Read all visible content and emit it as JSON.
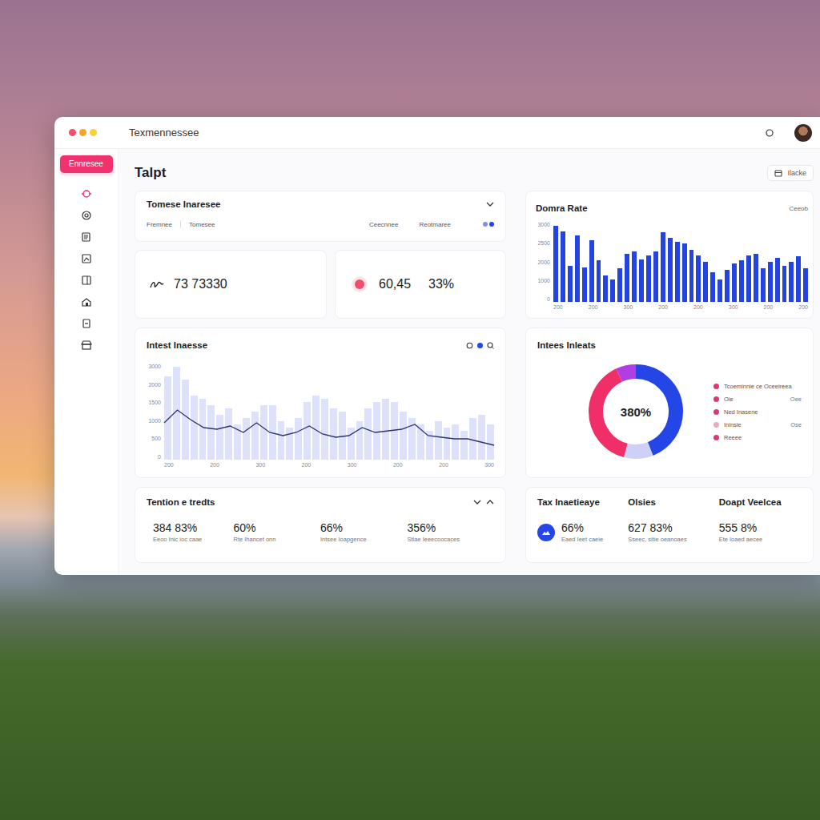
{
  "window": {
    "title": "Texmennessee",
    "dots": [
      {
        "color": "#f0506e"
      },
      {
        "color": "#f5a623"
      },
      {
        "color": "#f7d13c"
      }
    ]
  },
  "sidebar": {
    "button": "Ennresee"
  },
  "header": {
    "title": "Talpt",
    "action": "Ilacke"
  },
  "summary": {
    "title": "Tomese Inaresee",
    "labels": [
      "Fremnee",
      "Tomesee",
      "Ceecnnee",
      "Reotmaree"
    ],
    "primary": "73 73330",
    "secondary": "60,45",
    "percent": "33%"
  },
  "rate_chart": {
    "title": "Domra Rate",
    "action": "Ceeob",
    "y_ticks": [
      "3000",
      "2500",
      "2000",
      "1000",
      "0"
    ],
    "x_ticks": [
      "200",
      "200",
      "300",
      "200",
      "200",
      "300",
      "200",
      "200"
    ],
    "values": [
      2850,
      2650,
      1350,
      2500,
      1300,
      2300,
      1550,
      1000,
      850,
      1250,
      1800,
      1900,
      1600,
      1750,
      1900,
      2600,
      2400,
      2250,
      2200,
      1950,
      1750,
      1500,
      1100,
      850,
      1200,
      1450,
      1550,
      1750,
      1800,
      1250,
      1500,
      1650,
      1350,
      1500,
      1700,
      1250
    ]
  },
  "trend_chart": {
    "title": "Intest Inaesse",
    "y_ticks": [
      "3000",
      "2000",
      "1500",
      "1000",
      "500",
      "0"
    ],
    "x_ticks": [
      "200",
      "200",
      "300",
      "200",
      "300",
      "200",
      "200",
      "300"
    ],
    "bars": [
      2600,
      2900,
      2500,
      2000,
      1900,
      1700,
      1400,
      1600,
      1100,
      1300,
      1500,
      1700,
      1700,
      1200,
      1000,
      1300,
      1800,
      2000,
      1900,
      1600,
      1500,
      1000,
      1200,
      1600,
      1800,
      1900,
      1800,
      1500,
      1300,
      1100,
      900,
      1200,
      1000,
      1100,
      900,
      1300,
      1400,
      1100
    ],
    "line": [
      1150,
      1550,
      1250,
      1000,
      950,
      1050,
      850,
      1150,
      850,
      750,
      850,
      1050,
      800,
      700,
      750,
      1000,
      850,
      900,
      950,
      1100,
      750,
      700,
      650,
      650,
      550,
      450
    ]
  },
  "donut": {
    "title": "Intees Inleats",
    "center": "380%",
    "segments": [
      {
        "value": 44,
        "color": "#2446e6"
      },
      {
        "value": 10,
        "color": "#cfd0f5"
      },
      {
        "value": 39,
        "color": "#f02e68"
      },
      {
        "value": 7,
        "color": "#b03ee0"
      }
    ],
    "legend": [
      {
        "label": "Tcoeminnie ce Oceeireea",
        "color": "#e8336b"
      },
      {
        "label": "Oie",
        "value": "Oee",
        "color": "#e8336b"
      },
      {
        "label": "Ned Inasene",
        "color": "#e8336b"
      },
      {
        "label": "Ininsie",
        "value": "Ose",
        "color": "#f0a5bd"
      },
      {
        "label": "Reeee",
        "color": "#e8336b"
      }
    ]
  },
  "trends": {
    "title": "Tention e tredts",
    "stats": [
      {
        "value": "384 83%",
        "caption": "Eeoo Inic ioc caae"
      },
      {
        "value": "60%",
        "caption": "Rte Ihancet onn"
      },
      {
        "value": "66%",
        "caption": "Intsee Ioapgence"
      },
      {
        "value": "356%",
        "caption": "Stiae Ieeecoocaces"
      }
    ]
  },
  "tax": {
    "columns": [
      "Tax Inaetieaye",
      "Olsies",
      "Doapt Veelcea"
    ],
    "stats": [
      {
        "kind": "badge",
        "value": "66%",
        "caption": "Eaed Ieet caeie"
      },
      {
        "kind": "plain",
        "value": "627 83%",
        "caption": "Sseec, sitie oeanoaes"
      },
      {
        "kind": "plain",
        "value": "555 8%",
        "caption": "Ete Ioaed aecee"
      }
    ]
  }
}
